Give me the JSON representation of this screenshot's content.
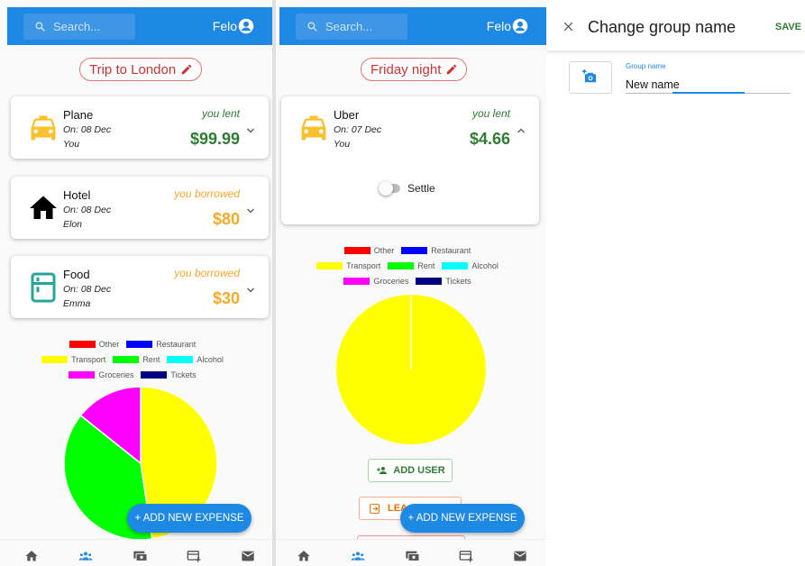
{
  "screen1": {
    "search_placeholder": "Search...",
    "user_name": "Felo",
    "group_name": "Trip to London",
    "expenses": [
      {
        "title": "Plane",
        "date": "On: 08 Dec",
        "person": "You",
        "relation": "you lent",
        "amount": "$99.99",
        "icon": "taxi-icon",
        "status": "lent"
      },
      {
        "title": "Hotel",
        "date": "On: 08 Dec",
        "person": "Elon",
        "relation": "you borrowed",
        "amount": "$80",
        "icon": "home-icon",
        "status": "borrowed"
      },
      {
        "title": "Food",
        "date": "On: 08 Dec",
        "person": "Emma",
        "relation": "you borrowed",
        "amount": "$30",
        "icon": "fridge-icon",
        "status": "borrowed"
      }
    ],
    "fab_label": "+ ADD NEW EXPENSE"
  },
  "screen2": {
    "search_placeholder": "Search...",
    "user_name": "Felo",
    "group_name": "Friday night",
    "expense": {
      "title": "Uber",
      "date": "On: 07 Dec",
      "person": "You",
      "relation": "you lent",
      "amount": "$4.66",
      "icon": "taxi-icon"
    },
    "settle_label": "Settle",
    "add_user_label": "ADD USER",
    "leave_label": "LEA",
    "fab_label": "+ ADD NEW EXPENSE"
  },
  "legend": {
    "rows": [
      [
        {
          "label": "Other",
          "color": "#ff0000"
        },
        {
          "label": "Restaurant",
          "color": "#0000ff"
        }
      ],
      [
        {
          "label": "Transport",
          "color": "#ffff00"
        },
        {
          "label": "Rent",
          "color": "#00ff00"
        },
        {
          "label": "Alcohol",
          "color": "#00ffff"
        }
      ],
      [
        {
          "label": "Groceries",
          "color": "#ff00ff"
        },
        {
          "label": "Tickets",
          "color": "#000080"
        }
      ]
    ]
  },
  "chart_data": [
    {
      "type": "pie",
      "categories": [
        "Transport",
        "Rent",
        "Groceries"
      ],
      "values": [
        99.99,
        80,
        30
      ],
      "colors": [
        "#ffff00",
        "#00ff00",
        "#ff00ff"
      ],
      "legend_position": "top"
    },
    {
      "type": "pie",
      "categories": [
        "Transport"
      ],
      "values": [
        4.66
      ],
      "colors": [
        "#ffff00"
      ],
      "legend_position": "top"
    }
  ],
  "dialog": {
    "title": "Change group name",
    "save_label": "SAVE",
    "field_label": "Group name",
    "field_value": "New name"
  },
  "colors": {
    "primary": "#1e88e5",
    "lent": "#2e7d32",
    "borrowed": "#f9a825",
    "group_name": "#d32f2f",
    "leave": "#ef6c00"
  }
}
